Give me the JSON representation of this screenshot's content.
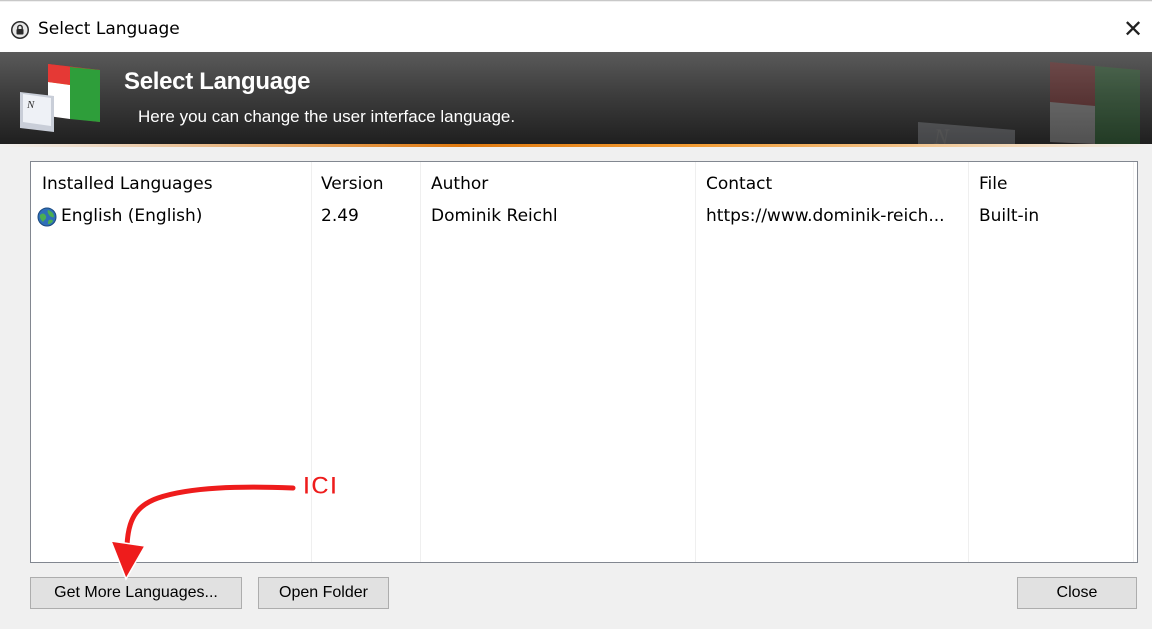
{
  "window": {
    "title": "Select Language",
    "close_glyph": "✕",
    "icons": {
      "title": "keepass-lock-icon",
      "close": "close-icon"
    }
  },
  "banner": {
    "title": "Select Language",
    "subtitle": "Here you can change the user interface language.",
    "logo_icon": "language-flag-keyboard-icon",
    "accent_color": "#e07a10"
  },
  "list": {
    "columns": [
      "Installed Languages",
      "Version",
      "Author",
      "Contact",
      "File"
    ],
    "rows": [
      {
        "icon": "globe-icon",
        "language": "English (English)",
        "version": "2.49",
        "author": "Dominik Reichl",
        "contact": "https://www.dominik-reich...",
        "file": "Built-in"
      }
    ]
  },
  "buttons": {
    "get_more": "Get More Languages...",
    "open_folder": "Open Folder",
    "close": "Close"
  },
  "annotation": {
    "label": "ICI",
    "color": "#ee1c1c"
  }
}
